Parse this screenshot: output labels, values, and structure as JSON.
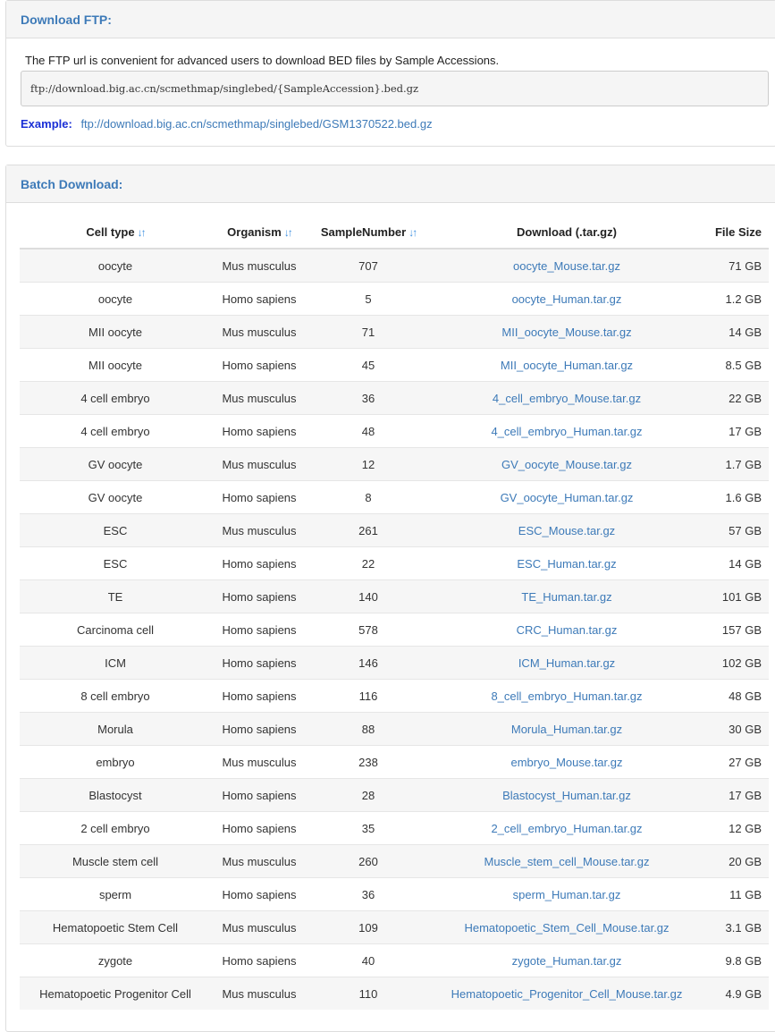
{
  "ftp": {
    "title": "Download FTP:",
    "description": "The FTP url is convenient for advanced users to download BED files by Sample Accessions.",
    "url_template": "ftp://download.big.ac.cn/scmethmap/singlebed/{SampleAccession}.bed.gz",
    "example_label": "Example:",
    "example_url": "ftp://download.big.ac.cn/scmethmap/singlebed/GSM1370522.bed.gz"
  },
  "batch": {
    "title": "Batch Download:",
    "sort_icon": "↓↑",
    "columns": [
      "Cell type",
      "Organism",
      "SampleNumber",
      "Download (.tar.gz)",
      "File Size"
    ],
    "rows": [
      [
        "oocyte",
        "Mus musculus",
        "707",
        "oocyte_Mouse.tar.gz",
        "71 GB"
      ],
      [
        "oocyte",
        "Homo sapiens",
        "5",
        "oocyte_Human.tar.gz",
        "1.2 GB"
      ],
      [
        "MII oocyte",
        "Mus musculus",
        "71",
        "MII_oocyte_Mouse.tar.gz",
        "14 GB"
      ],
      [
        "MII oocyte",
        "Homo sapiens",
        "45",
        "MII_oocyte_Human.tar.gz",
        "8.5 GB"
      ],
      [
        "4 cell embryo",
        "Mus musculus",
        "36",
        "4_cell_embryo_Mouse.tar.gz",
        "22 GB"
      ],
      [
        "4 cell embryo",
        "Homo sapiens",
        "48",
        "4_cell_embryo_Human.tar.gz",
        "17 GB"
      ],
      [
        "GV oocyte",
        "Mus musculus",
        "12",
        "GV_oocyte_Mouse.tar.gz",
        "1.7 GB"
      ],
      [
        "GV oocyte",
        "Homo sapiens",
        "8",
        "GV_oocyte_Human.tar.gz",
        "1.6 GB"
      ],
      [
        "ESC",
        "Mus musculus",
        "261",
        "ESC_Mouse.tar.gz",
        "57 GB"
      ],
      [
        "ESC",
        "Homo sapiens",
        "22",
        "ESC_Human.tar.gz",
        "14 GB"
      ],
      [
        "TE",
        "Homo sapiens",
        "140",
        "TE_Human.tar.gz",
        "101 GB"
      ],
      [
        "Carcinoma cell",
        "Homo sapiens",
        "578",
        "CRC_Human.tar.gz",
        "157 GB"
      ],
      [
        "ICM",
        "Homo sapiens",
        "146",
        "ICM_Human.tar.gz",
        "102 GB"
      ],
      [
        "8 cell embryo",
        "Homo sapiens",
        "116",
        "8_cell_embryo_Human.tar.gz",
        "48 GB"
      ],
      [
        "Morula",
        "Homo sapiens",
        "88",
        "Morula_Human.tar.gz",
        "30 GB"
      ],
      [
        "embryo",
        "Mus musculus",
        "238",
        "embryo_Mouse.tar.gz",
        "27 GB"
      ],
      [
        "Blastocyst",
        "Homo sapiens",
        "28",
        "Blastocyst_Human.tar.gz",
        "17 GB"
      ],
      [
        "2 cell embryo",
        "Homo sapiens",
        "35",
        "2_cell_embryo_Human.tar.gz",
        "12 GB"
      ],
      [
        "Muscle stem cell",
        "Mus musculus",
        "260",
        "Muscle_stem_cell_Mouse.tar.gz",
        "20 GB"
      ],
      [
        "sperm",
        "Homo sapiens",
        "36",
        "sperm_Human.tar.gz",
        "11 GB"
      ],
      [
        "Hematopoetic Stem Cell",
        "Mus musculus",
        "109",
        "Hematopoetic_Stem_Cell_Mouse.tar.gz",
        "3.1 GB"
      ],
      [
        "zygote",
        "Homo sapiens",
        "40",
        "zygote_Human.tar.gz",
        "9.8 GB"
      ],
      [
        "Hematopoetic Progenitor Cell",
        "Mus musculus",
        "110",
        "Hematopoetic_Progenitor_Cell_Mouse.tar.gz",
        "4.9 GB"
      ]
    ]
  },
  "colors": {
    "heading_text": "#3d7ab8",
    "link": "#3d7ab8",
    "example_label": "#1a2fd6",
    "sort_icon": "#3b8fe0"
  }
}
